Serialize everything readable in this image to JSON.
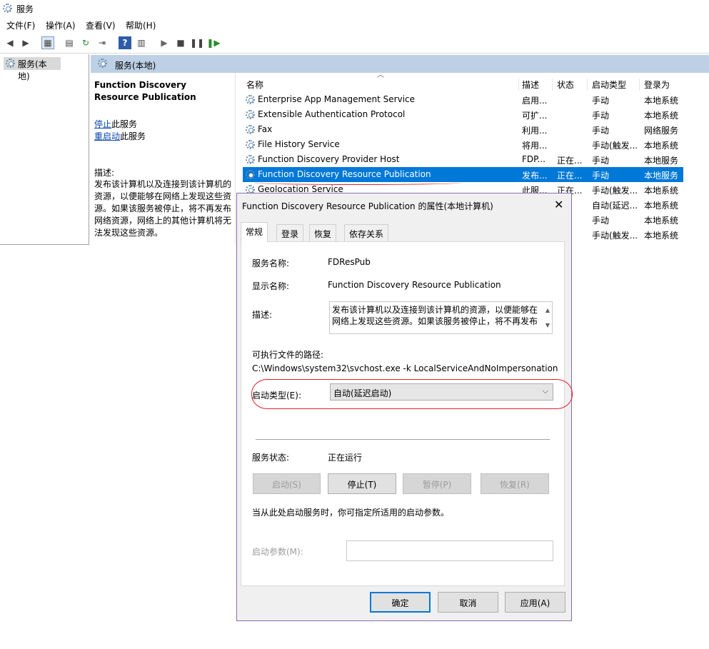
{
  "app": {
    "title": "服务"
  },
  "menu": {
    "file": "文件(F)",
    "action": "操作(A)",
    "view": "查看(V)",
    "help": "帮助(H)"
  },
  "tree": {
    "node_label": "服务(本地)"
  },
  "pane_header": {
    "title": "服务(本地)"
  },
  "desc_pane": {
    "service_name": "Function Discovery Resource Publication",
    "stop_link": "停止",
    "stop_suffix": "此服务",
    "restart_link": "重启动",
    "restart_suffix": "此服务",
    "desc_label": "描述:",
    "desc_text": "发布该计算机以及连接到该计算机的资源，以便能够在网络上发现这些资源。如果该服务被停止，将不再发布网络资源，网络上的其他计算机将无法发现这些资源。"
  },
  "list": {
    "columns": {
      "name": "名称",
      "desc": "描述",
      "status": "状态",
      "startup": "启动类型",
      "logon": "登录为"
    },
    "rows": [
      {
        "name": "Enterprise App Management Service",
        "desc": "启用...",
        "status": "",
        "startup": "手动",
        "logon": "本地系统"
      },
      {
        "name": "Extensible Authentication Protocol",
        "desc": "可扩...",
        "status": "",
        "startup": "手动",
        "logon": "本地系统"
      },
      {
        "name": "Fax",
        "desc": "利用...",
        "status": "",
        "startup": "手动",
        "logon": "网络服务"
      },
      {
        "name": "File History Service",
        "desc": "将用...",
        "status": "",
        "startup": "手动(触发...",
        "logon": "本地系统"
      },
      {
        "name": "Function Discovery Provider Host",
        "desc": "FDP...",
        "status": "正在...",
        "startup": "手动",
        "logon": "本地服务"
      },
      {
        "name": "Function Discovery Resource Publication",
        "desc": "发布...",
        "status": "正在...",
        "startup": "手动",
        "logon": "本地服务"
      },
      {
        "name": "Geolocation Service",
        "desc": "此服...",
        "status": "正在...",
        "startup": "手动(触发...",
        "logon": "本地系统"
      }
    ],
    "hidden_rows": [
      {
        "startup": "自动(延迟...",
        "logon": "本地系统"
      },
      {
        "startup": "手动",
        "logon": "本地系统"
      },
      {
        "startup": "手动(触发...",
        "logon": "本地系统"
      }
    ]
  },
  "dialog": {
    "title": "Function Discovery Resource Publication 的属性(本地计算机)",
    "close": "✕",
    "tabs": [
      "常规",
      "登录",
      "恢复",
      "依存关系"
    ],
    "service_name_label": "服务名称:",
    "service_name_value": "FDResPub",
    "display_name_label": "显示名称:",
    "display_name_value": "Function Discovery Resource Publication",
    "description_label": "描述:",
    "description_value": "发布该计算机以及连接到该计算机的资源，以便能够在网络上发现这些资源。如果该服务被停止，将不再发布",
    "path_label": "可执行文件的路径:",
    "path_value": "C:\\Windows\\system32\\svchost.exe -k LocalServiceAndNoImpersonation",
    "startup_type_label": "启动类型(E):",
    "startup_type_value": "自动(延迟启动)",
    "status_label": "服务状态:",
    "status_value": "正在运行",
    "btn_start": "启动(S)",
    "btn_stop": "停止(T)",
    "btn_pause": "暂停(P)",
    "btn_resume": "恢复(R)",
    "hint": "当从此处启动服务时，你可指定所适用的启动参数。",
    "param_label": "启动参数(M):",
    "param_value": "",
    "ok": "确定",
    "cancel": "取消",
    "apply": "应用(A)"
  }
}
